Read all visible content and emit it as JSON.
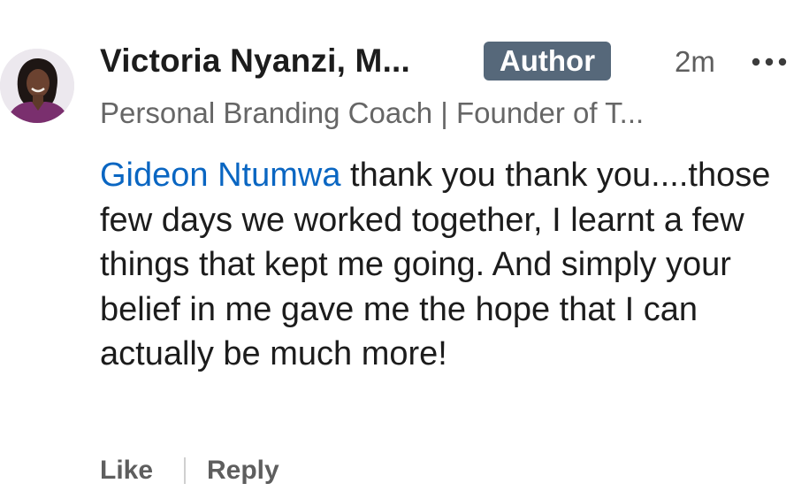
{
  "comment": {
    "author_name": "Victoria Nyanzi, M...",
    "author_badge": "Author",
    "timestamp": "2m",
    "headline": "Personal Branding Coach | Founder of T...",
    "mention": "Gideon Ntumwa",
    "text": " thank you thank you....those few days we worked together, I learnt a few things that kept me going. And simply your belief in me gave me the hope that I can actually be much more!",
    "more_icon": "ellipsis-icon",
    "avatar_icon": "profile-photo"
  },
  "actions": {
    "like_label": "Like",
    "reply_label": "Reply"
  },
  "colors": {
    "badge_bg": "#56687a",
    "mention": "#0a66c2",
    "secondary_text": "#666666"
  }
}
